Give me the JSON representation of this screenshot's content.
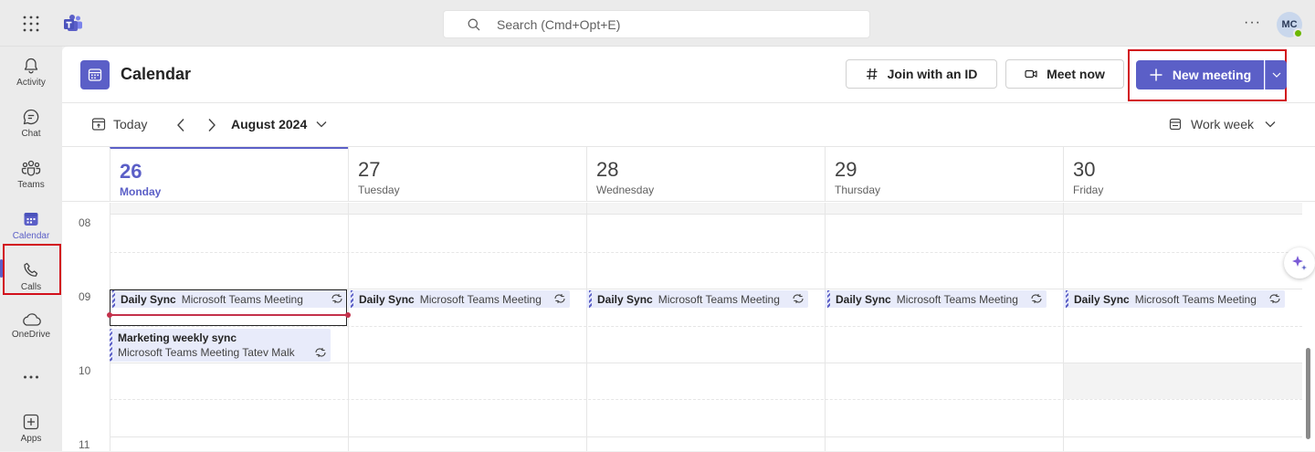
{
  "topbar": {
    "search_placeholder": "Search (Cmd+Opt+E)",
    "more": "···",
    "avatar_initials": "MC"
  },
  "rail": {
    "items": [
      {
        "label": "Activity",
        "icon": "bell-icon"
      },
      {
        "label": "Chat",
        "icon": "chat-icon"
      },
      {
        "label": "Teams",
        "icon": "teams-icon"
      },
      {
        "label": "Calendar",
        "icon": "calendar-icon",
        "active": true
      },
      {
        "label": "Calls",
        "icon": "phone-icon"
      },
      {
        "label": "OneDrive",
        "icon": "cloud-icon"
      },
      {
        "label": "",
        "icon": "more-icon"
      },
      {
        "label": "Apps",
        "icon": "add-app-icon"
      }
    ]
  },
  "header": {
    "title": "Calendar",
    "join_label": "Join with an ID",
    "meet_label": "Meet now",
    "new_label": "New meeting"
  },
  "toolbar": {
    "today": "Today",
    "month": "August 2024",
    "view": "Work week"
  },
  "days": [
    {
      "num": "26",
      "name": "Monday",
      "today": true
    },
    {
      "num": "27",
      "name": "Tuesday"
    },
    {
      "num": "28",
      "name": "Wednesday"
    },
    {
      "num": "29",
      "name": "Thursday"
    },
    {
      "num": "30",
      "name": "Friday"
    }
  ],
  "hours": [
    "08",
    "09",
    "10",
    "11"
  ],
  "events": {
    "daily_title": "Daily Sync",
    "daily_location": "Microsoft Teams Meeting",
    "marketing_title": "Marketing weekly sync",
    "marketing_sub": "Microsoft Teams Meeting  Tatev Malk"
  },
  "colors": {
    "accent": "#5b5fc7",
    "highlight": "#d20f1b"
  }
}
